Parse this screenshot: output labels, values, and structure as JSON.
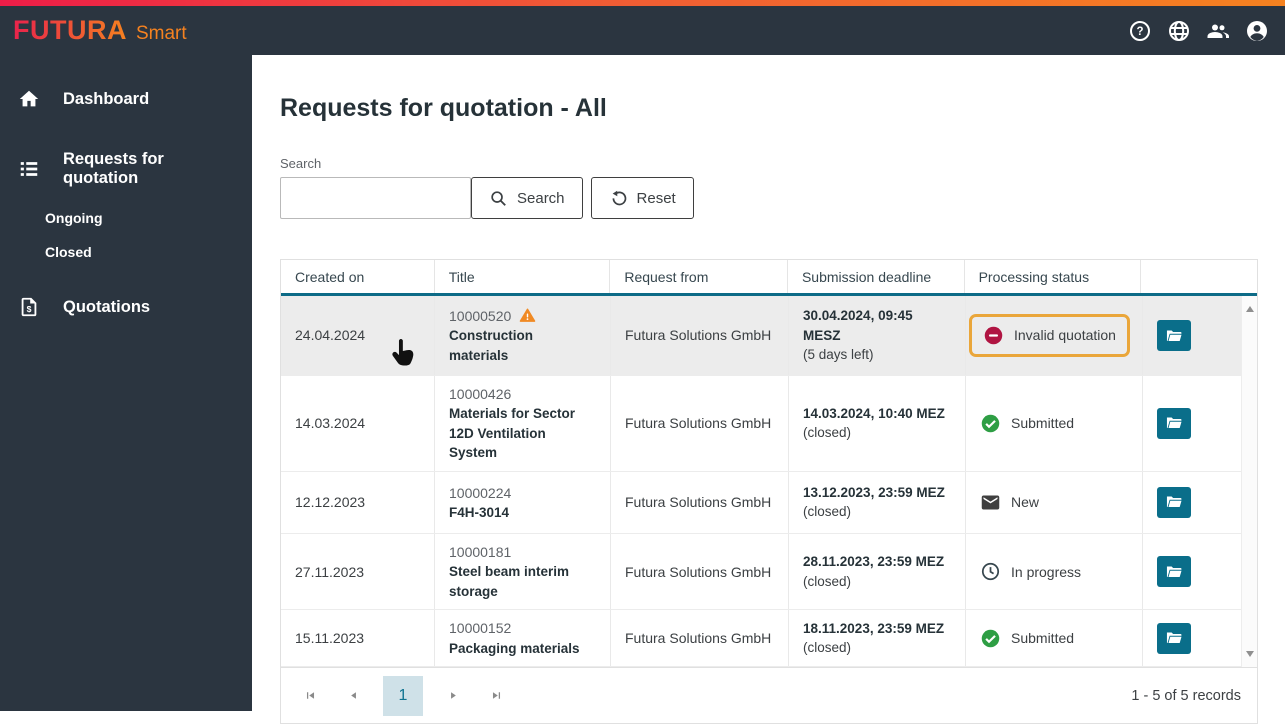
{
  "colors": {
    "topbar_gradient_start": "#ee1d48",
    "topbar_gradient_end": "#f58220",
    "dark_navy": "#2b3540",
    "teal_accent": "#0a6e8a",
    "status_red": "#b01442",
    "status_green": "#2e9e44",
    "warning_orange": "#f08a24",
    "highlight_box_border": "#eaa63a",
    "selected_row_bg": "#ececec"
  },
  "header": {
    "brand": "FUTURA",
    "brand_suffix": "Smart",
    "icons": [
      "help-icon",
      "globe-icon",
      "users-icon",
      "account-icon"
    ]
  },
  "sidebar": {
    "items": [
      {
        "label": "Dashboard",
        "icon": "home-icon"
      },
      {
        "label": "Requests for quotation",
        "icon": "list-icon",
        "children": [
          {
            "label": "Ongoing"
          },
          {
            "label": "Closed"
          }
        ]
      },
      {
        "label": "Quotations",
        "icon": "quotation-icon"
      }
    ]
  },
  "main": {
    "title": "Requests for quotation - All",
    "search": {
      "label": "Search",
      "value": "",
      "search_button": "Search",
      "search_icon": "search-icon",
      "reset_button": "Reset",
      "reset_icon": "reset-icon"
    }
  },
  "table": {
    "columns": [
      "Created on",
      "Title",
      "Request from",
      "Submission deadline",
      "Processing status",
      ""
    ],
    "action_icon": "folder-open-icon",
    "rows": [
      {
        "created_on": "24.04.2024",
        "ref": "10000520",
        "warning": true,
        "warning_icon": "warning-icon",
        "title": "Construction materials",
        "request_from": "Futura Solutions GmbH",
        "deadline": "30.04.2024, 09:45 MESZ",
        "deadline_note": "(5 days left)",
        "status": {
          "label": "Invalid quotation",
          "icon": "minus-circle-icon",
          "color": "#b01442",
          "highlighted": true
        },
        "selected": true
      },
      {
        "created_on": "14.03.2024",
        "ref": "10000426",
        "warning": false,
        "title": "Materials for Sector 12D Ventilation System",
        "request_from": "Futura Solutions GmbH",
        "deadline": "14.03.2024, 10:40 MEZ",
        "deadline_note": "(closed)",
        "status": {
          "label": "Submitted",
          "icon": "check-circle-icon",
          "color": "#2e9e44",
          "highlighted": false
        },
        "selected": false
      },
      {
        "created_on": "12.12.2023",
        "ref": "10000224",
        "warning": false,
        "title": "F4H-3014",
        "request_from": "Futura Solutions GmbH",
        "deadline": "13.12.2023, 23:59 MEZ",
        "deadline_note": "(closed)",
        "status": {
          "label": "New",
          "icon": "mail-icon",
          "color": "#3f3f3f",
          "highlighted": false
        },
        "selected": false
      },
      {
        "created_on": "27.11.2023",
        "ref": "10000181",
        "warning": false,
        "title": "Steel beam interim storage",
        "request_from": "Futura Solutions GmbH",
        "deadline": "28.11.2023, 23:59 MEZ",
        "deadline_note": "(closed)",
        "status": {
          "label": "In progress",
          "icon": "clock-icon",
          "color": "#37474f",
          "highlighted": false
        },
        "selected": false
      },
      {
        "created_on": "15.11.2023",
        "ref": "10000152",
        "warning": false,
        "title": "Packaging materials",
        "request_from": "Futura Solutions GmbH",
        "deadline": "18.11.2023, 23:59 MEZ",
        "deadline_note": "(closed)",
        "status": {
          "label": "Submitted",
          "icon": "check-circle-icon",
          "color": "#2e9e44",
          "highlighted": false
        },
        "selected": false
      }
    ]
  },
  "pagination": {
    "current_page": "1",
    "records_text": "1 - 5 of 5 records",
    "icons": [
      "first-page-icon",
      "prev-page-icon",
      "next-page-icon",
      "last-page-icon"
    ]
  }
}
